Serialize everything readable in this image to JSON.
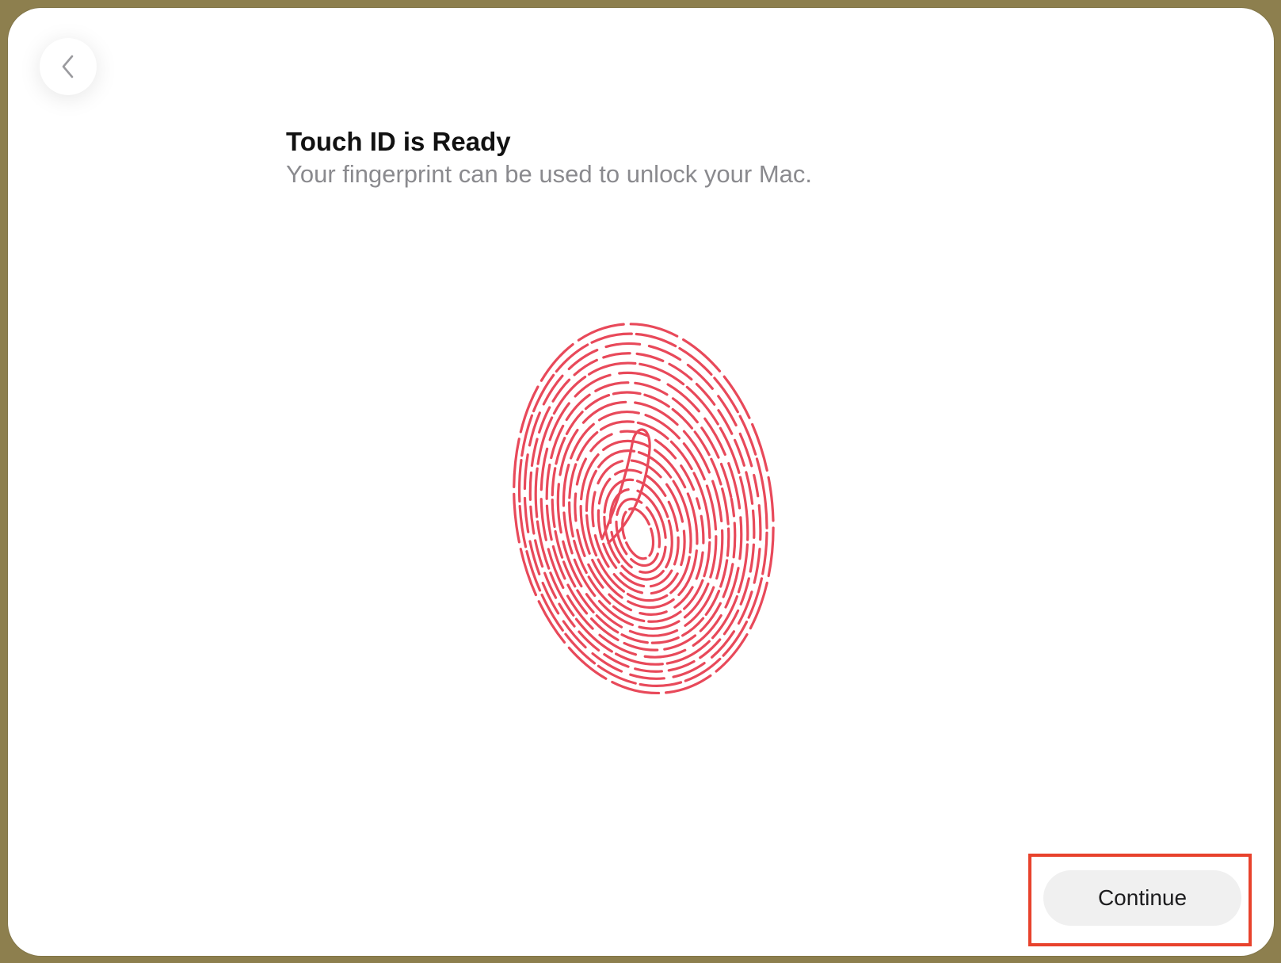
{
  "header": {
    "title": "Touch ID is Ready",
    "subtitle": "Your fingerprint can be used to unlock your Mac."
  },
  "navigation": {
    "back_icon": "chevron-left-icon"
  },
  "illustration": {
    "icon": "fingerprint-icon",
    "color": "#e8495a"
  },
  "footer": {
    "continue_label": "Continue",
    "highlight_color": "#e8422c"
  }
}
